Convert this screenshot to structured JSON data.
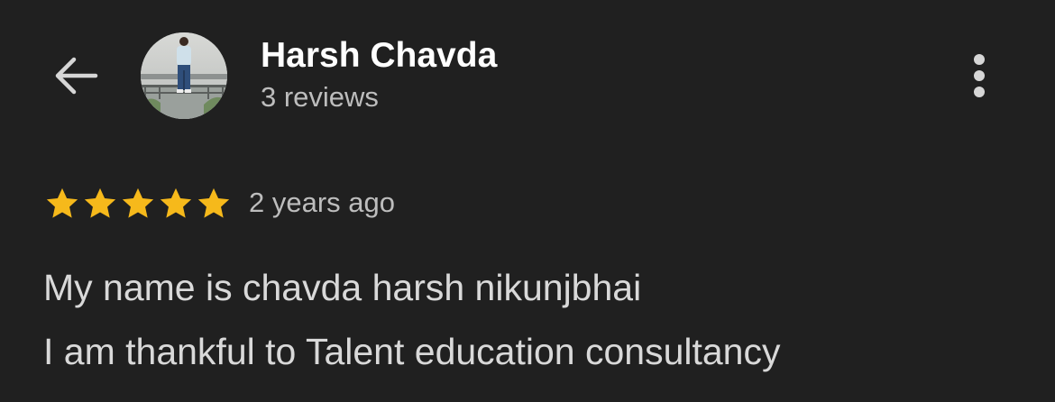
{
  "header": {
    "back_icon": "arrow-left-icon",
    "avatar_icon": "profile-photo",
    "reviewer_name": "Harsh Chavda",
    "review_count": "3 reviews",
    "more_icon": "more-vertical-icon"
  },
  "review": {
    "rating": 5,
    "rating_max": 5,
    "star_color": "#f6b91b",
    "age": "2 years ago",
    "text_lines": [
      "My name is chavda harsh nikunjbhai",
      "I am thankful to Talent education consultancy"
    ]
  }
}
